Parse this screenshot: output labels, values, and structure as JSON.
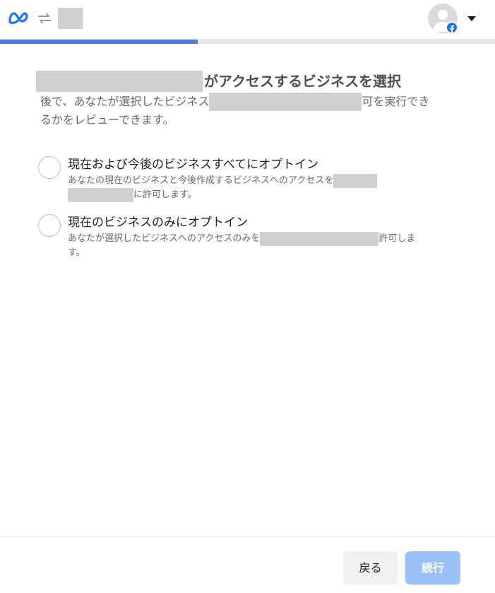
{
  "header": {
    "meta_logo_icon": "meta-logo",
    "swap_icon": "swap-arrows-icon",
    "avatar_icon": "user-avatar",
    "badge_icon": "facebook-badge-icon",
    "menu_icon": "caret-down-icon"
  },
  "progress": {
    "fraction": 0.4
  },
  "main": {
    "title_suffix": "がアクセスするビジネスを選択",
    "subtitle_part1": "後で、あなたが選択したビジネス",
    "subtitle_part2": "可を実行でき",
    "subtitle_part3": "るかをレビューできます。"
  },
  "options": [
    {
      "label": "現在および今後のビジネスすべてにオプトイン",
      "desc_part1": "あなたの現在のビジネスと今後作成するビジネスへのアクセスを",
      "desc_part2": "に許可します。"
    },
    {
      "label": "現在のビジネスのみにオプトイン",
      "desc_part1": "あなたが選択したビジネスへのアクセスのみを",
      "desc_part2": "許可しま",
      "desc_part3": "す。"
    }
  ],
  "footer": {
    "back_label": "戻る",
    "continue_label": "続行"
  },
  "colors": {
    "accent": "#4a7fd4",
    "continue_disabled": "#99c0f7",
    "facebook_blue": "#1877f2"
  }
}
